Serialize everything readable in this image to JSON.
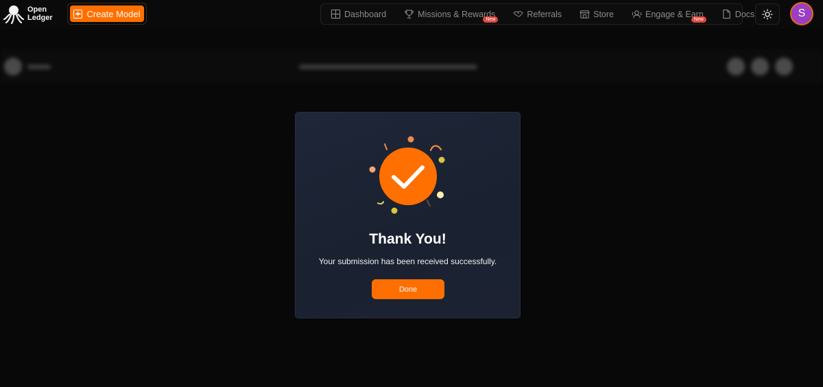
{
  "brand": {
    "logo_icon": "octopus-logo-icon",
    "name_line1": "Open",
    "name_line2": "Ledger"
  },
  "toolbar": {
    "create_model_label": "Create Model"
  },
  "nav": {
    "items": [
      {
        "label": "Dashboard",
        "icon": "dashboard-icon"
      },
      {
        "label": "Missions & Rewards",
        "icon": "trophy-icon",
        "badge": "New"
      },
      {
        "label": "Referrals",
        "icon": "handshake-icon"
      },
      {
        "label": "Store",
        "icon": "store-icon"
      },
      {
        "label": "Engage & Earn",
        "icon": "engage-icon",
        "badge": "New"
      },
      {
        "label": "Docs",
        "icon": "document-icon"
      }
    ],
    "theme_icon": "sun-icon"
  },
  "user": {
    "avatar_initial": "S"
  },
  "modal": {
    "icon": "checkmark-celebration-icon",
    "title": "Thank You!",
    "message": "Your submission has been received successfully.",
    "done_label": "Done"
  },
  "colors": {
    "accent": "#ff6f00",
    "badge": "#e0463b",
    "avatar_bg": "#9b3fc0",
    "modal_bg": "#1e2638",
    "page_bg": "#080808"
  }
}
